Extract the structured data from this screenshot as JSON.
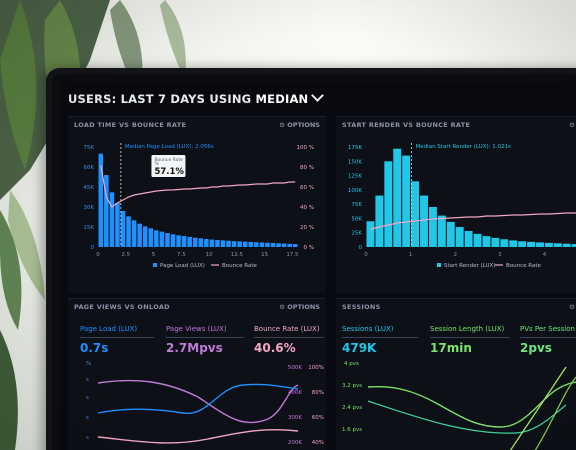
{
  "header": {
    "title_prefix": "USERS: LAST 7 DAYS USING ",
    "title_emph": "MEDIAN"
  },
  "colors": {
    "blue": "#1e90ff",
    "cyan": "#22c7e8",
    "pink": "#f3a6c6",
    "purple": "#c07ad8",
    "green": "#6ee67e"
  },
  "options_label": "OPTIONS",
  "panels": {
    "p1": {
      "title": "LOAD TIME VS BOUNCE RATE",
      "median_label": "Median Page Load (LUX): 2.056s",
      "tooltip": {
        "label": "Bounce Rate",
        "sub": "%",
        "value": "57.1%"
      },
      "legend": [
        "Page Load (LUX)",
        "Bounce Rate"
      ],
      "y_left": [
        "75K",
        "60K",
        "45K",
        "30K",
        "15K",
        "0"
      ],
      "y_right": [
        "100 %",
        "80 %",
        "60 %",
        "40 %",
        "20 %",
        "0 %"
      ],
      "x_ticks": [
        "0",
        "2.5",
        "5",
        "7.5",
        "10",
        "12.5",
        "15",
        "17.5"
      ]
    },
    "p2": {
      "title": "START RENDER VS BOUNCE RATE",
      "median_label": "Median Start Render (LUX): 1.021s",
      "legend": [
        "Start Render (LUX)",
        "Bounce Rate"
      ],
      "y_left": [
        "175K",
        "150K",
        "125K",
        "100K",
        "75K",
        "50K",
        "25K",
        "0"
      ],
      "x_ticks": [
        "0",
        "1",
        "2",
        "3",
        "4",
        "5"
      ]
    },
    "p3": {
      "title": "PAGE VIEWS VS ONLOAD",
      "metrics": [
        {
          "label": "Page Load (LUX)",
          "value": "0.7s"
        },
        {
          "label": "Page Views (LUX)",
          "value": "2.7Mpvs"
        },
        {
          "label": "Bounce Rate (LUX)",
          "value": "40.6%"
        }
      ],
      "y_left": [
        "%",
        "s"
      ],
      "y_right1": [
        "500K",
        "400K",
        "300K",
        "200K"
      ],
      "y_right2": [
        "100%",
        "80%",
        "60%",
        "40%"
      ]
    },
    "p4": {
      "title": "SESSIONS",
      "metrics": [
        {
          "label": "Sessions (LUX)",
          "value": "479K"
        },
        {
          "label": "Session Length (LUX)",
          "value": "17min"
        },
        {
          "label": "PVs Per Session (L",
          "value": "2pvs"
        }
      ],
      "y_left": [
        "4 pvs",
        "3.2 pvs",
        "2.4 pvs",
        "1.6 pvs"
      ]
    }
  },
  "chart_data": [
    {
      "type": "bar",
      "title": "LOAD TIME VS BOUNCE RATE",
      "xlabel": "",
      "ylabel": "",
      "ylim": [
        0,
        75000
      ],
      "x": [
        0.25,
        0.75,
        1.25,
        1.75,
        2.25,
        2.75,
        3.25,
        3.75,
        4.25,
        4.75,
        5.25,
        5.75,
        6.25,
        6.75,
        7.25,
        7.75,
        8.25,
        8.75,
        9.25,
        9.75,
        10.25,
        10.75,
        11.25,
        11.75,
        12.25,
        12.75,
        13.25,
        13.75,
        14.25,
        14.75,
        15.25,
        15.75,
        16.25,
        16.75,
        17.25,
        17.75
      ],
      "series": [
        {
          "name": "Page Load (LUX)",
          "values": [
            70000,
            54000,
            41000,
            33000,
            27000,
            23000,
            20000,
            17500,
            15500,
            14000,
            12500,
            11500,
            10500,
            9500,
            8800,
            8200,
            7600,
            7000,
            6500,
            6000,
            5600,
            5300,
            5000,
            4700,
            4400,
            4200,
            4000,
            3800,
            3600,
            3400,
            3200,
            3000,
            2800,
            2600,
            2400,
            2200
          ]
        },
        {
          "name": "Bounce Rate",
          "values": [
            82,
            50,
            40,
            44,
            47,
            50,
            52,
            53,
            54,
            55,
            56,
            56.5,
            57,
            57.1,
            57.5,
            58,
            58,
            58.5,
            59,
            59,
            60,
            60,
            61,
            61,
            61.5,
            62,
            62,
            62.5,
            63,
            63,
            63,
            64,
            64,
            64,
            65,
            65
          ]
        }
      ]
    },
    {
      "type": "bar",
      "title": "START RENDER VS BOUNCE RATE",
      "xlabel": "",
      "ylabel": "",
      "ylim": [
        0,
        175000
      ],
      "x": [
        0.1,
        0.3,
        0.5,
        0.7,
        0.9,
        1.1,
        1.3,
        1.5,
        1.7,
        1.9,
        2.1,
        2.3,
        2.5,
        2.7,
        2.9,
        3.1,
        3.3,
        3.5,
        3.7,
        3.9,
        4.1,
        4.3,
        4.5,
        4.7,
        4.9,
        5.1
      ],
      "series": [
        {
          "name": "Start Render (LUX)",
          "values": [
            45000,
            90000,
            150000,
            172000,
            160000,
            115000,
            90000,
            70000,
            55000,
            44000,
            35000,
            28000,
            23000,
            19000,
            16000,
            13500,
            11500,
            10000,
            9000,
            8000,
            7200,
            6500,
            5800,
            5200,
            4700,
            4200
          ]
        },
        {
          "name": "Bounce Rate",
          "values": [
            18,
            20,
            22,
            24,
            25,
            26,
            27,
            28,
            28.5,
            29,
            29.5,
            30,
            30,
            31,
            31,
            31.5,
            32,
            32,
            32.5,
            33,
            33,
            33.5,
            34,
            34,
            34.5,
            35
          ]
        }
      ]
    }
  ]
}
